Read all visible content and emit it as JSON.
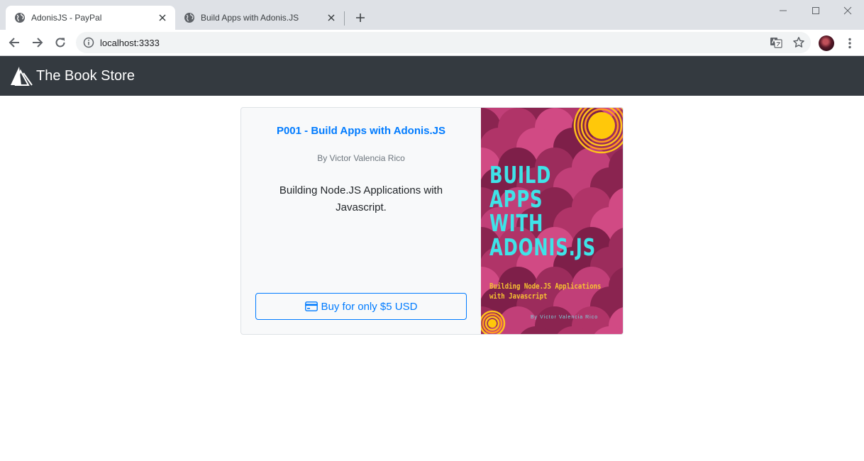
{
  "browser": {
    "tabs": [
      {
        "title": "AdonisJS - PayPal",
        "active": true
      },
      {
        "title": "Build Apps with Adonis.JS",
        "active": false
      }
    ],
    "address": "localhost:3333"
  },
  "navbar": {
    "brand": "The Book Store"
  },
  "product": {
    "title": "P001 - Build Apps with Adonis.JS",
    "author": "By Victor Valencia Rico",
    "description": "Building Node.JS Applications with Javascript.",
    "buy_label": "Buy for only $5 USD",
    "cover": {
      "title_lines": [
        "BUILD",
        "APPS",
        "WITH",
        "ADONIS.JS"
      ],
      "subtitle_lines": [
        "Building Node.JS Applications",
        "with Javascript"
      ],
      "author": "By Victor Valencia Rico"
    }
  },
  "colors": {
    "navbar_bg": "#343a40",
    "accent": "#007bff",
    "cover_bg": "#b13a6c",
    "cover_title": "#3fe3e8",
    "cover_subtitle": "#f7c331"
  }
}
